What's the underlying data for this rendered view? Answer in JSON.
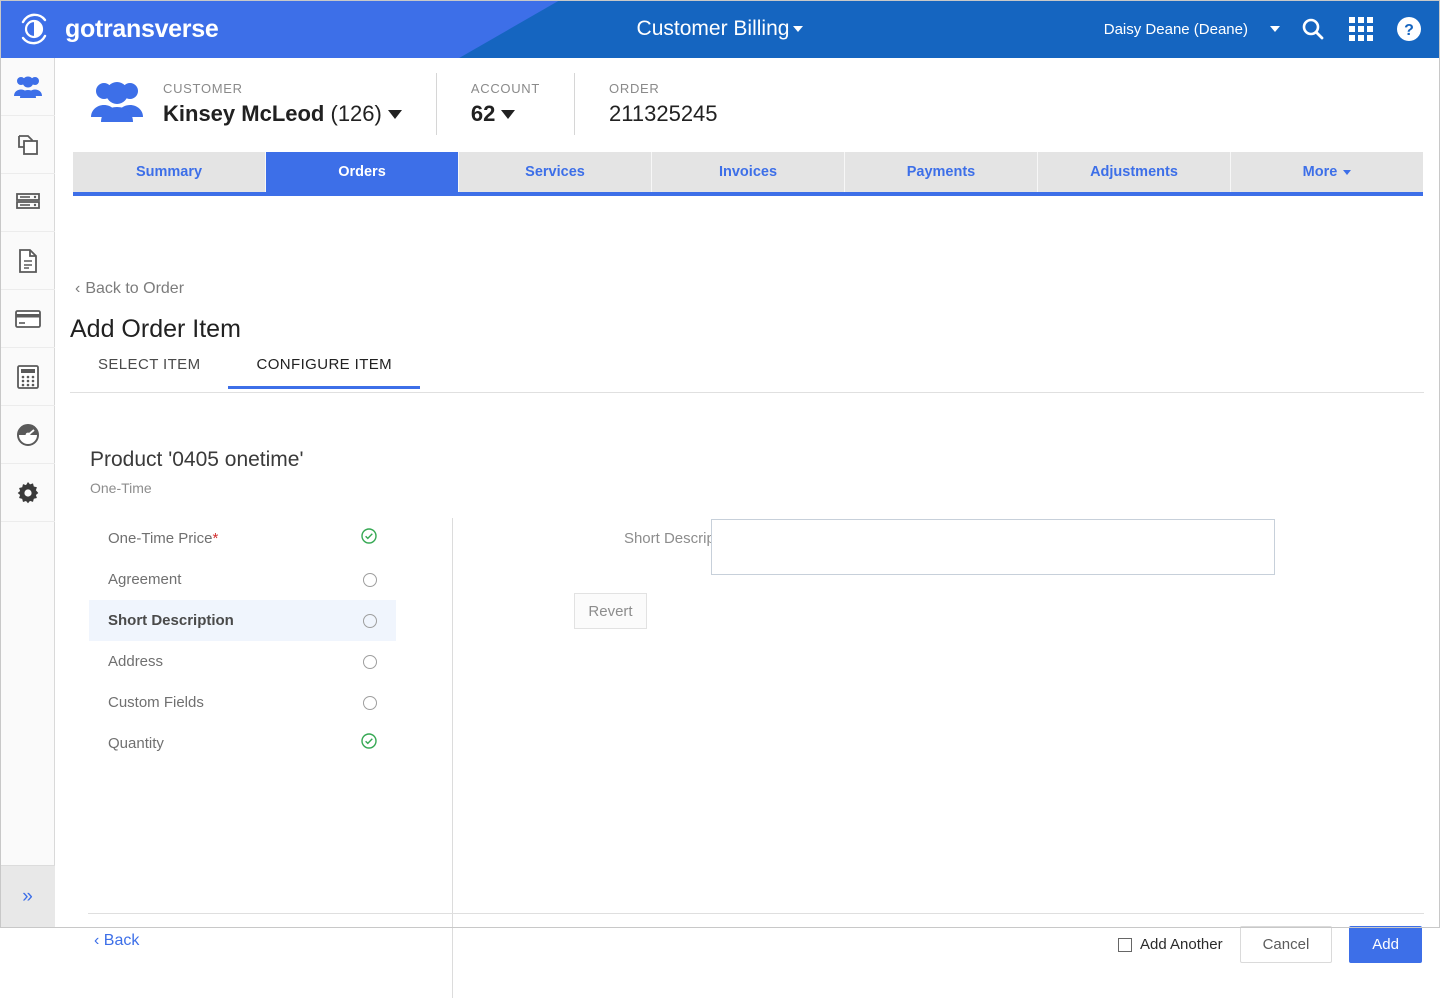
{
  "brand": {
    "logo_text": "gotransverse",
    "accent_blue": "#3d6fe8",
    "header_blue": "#1565c0",
    "green": "#35a853",
    "required_red": "#d32f2f"
  },
  "header": {
    "app_title": "Customer Billing",
    "user": "Daisy Deane (Deane)",
    "icons": [
      "search-icon",
      "apps-grid-icon",
      "help-icon"
    ]
  },
  "sidebar": {
    "items": [
      {
        "name": "customers-icon",
        "active": true
      },
      {
        "name": "products-icon",
        "active": false
      },
      {
        "name": "servers-icon",
        "active": false
      },
      {
        "name": "documents-icon",
        "active": false
      },
      {
        "name": "payments-card-icon",
        "active": false
      },
      {
        "name": "calculator-icon",
        "active": false
      },
      {
        "name": "dashboard-gauge-icon",
        "active": false
      },
      {
        "name": "settings-gear-icon",
        "active": false
      }
    ],
    "expand_glyph": "»"
  },
  "context_bar": {
    "customer": {
      "label": "Customer",
      "name": "Kinsey McLeod",
      "id": "(126)"
    },
    "account": {
      "label": "Account",
      "value": "62"
    },
    "order": {
      "label": "Order",
      "value": "211325245"
    }
  },
  "tabs": [
    {
      "label": "Summary",
      "active": false,
      "caret": false
    },
    {
      "label": "Orders",
      "active": true,
      "caret": false
    },
    {
      "label": "Services",
      "active": false,
      "caret": false
    },
    {
      "label": "Invoices",
      "active": false,
      "caret": false
    },
    {
      "label": "Payments",
      "active": false,
      "caret": false
    },
    {
      "label": "Adjustments",
      "active": false,
      "caret": false
    },
    {
      "label": "More",
      "active": false,
      "caret": true
    }
  ],
  "page": {
    "back_to_order": "Back to Order",
    "title": "Add Order Item",
    "subtabs": [
      {
        "label": "SELECT ITEM",
        "active": false
      },
      {
        "label": "CONFIGURE ITEM",
        "active": true
      }
    ],
    "product_heading": "Product '0405 onetime'",
    "product_type": "One-Time"
  },
  "attributes": [
    {
      "label": "One-Time Price",
      "required": true,
      "status": "complete",
      "selected": false
    },
    {
      "label": "Agreement",
      "required": false,
      "status": "empty",
      "selected": false
    },
    {
      "label": "Short Description",
      "required": false,
      "status": "empty",
      "selected": true
    },
    {
      "label": "Address",
      "required": false,
      "status": "empty",
      "selected": false
    },
    {
      "label": "Custom Fields",
      "required": false,
      "status": "empty",
      "selected": false
    },
    {
      "label": "Quantity",
      "required": false,
      "status": "complete",
      "selected": false
    }
  ],
  "form": {
    "field_label": "Short Description",
    "field_value": "",
    "field_placeholder": "",
    "revert_label": "Revert"
  },
  "footer": {
    "back_label": "Back",
    "add_another_label": "Add Another",
    "add_another_checked": false,
    "cancel_label": "Cancel",
    "add_label": "Add"
  }
}
